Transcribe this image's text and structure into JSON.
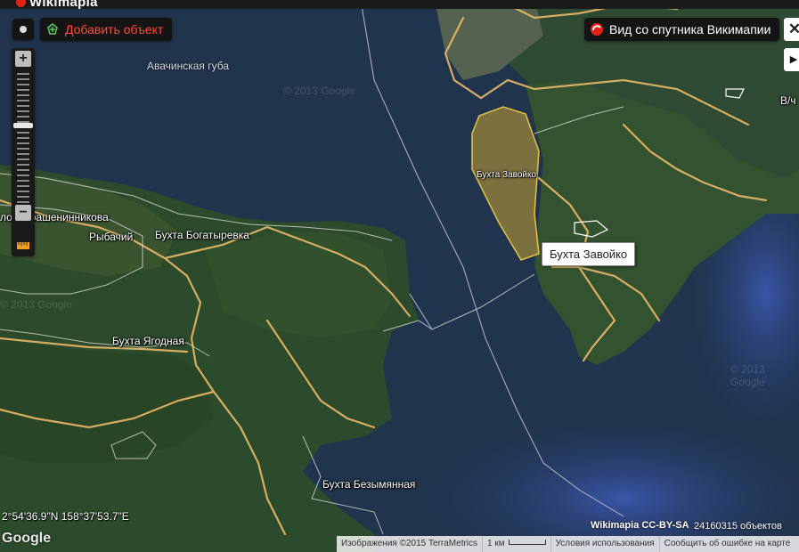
{
  "app": {
    "brand": "Wikimapia"
  },
  "toolbar": {
    "add_object_label": "Добавить объект",
    "satellite_view_label": "Вид со спутника Викимапии",
    "close_label": "✕",
    "expand_label": "▶"
  },
  "zoom": {
    "plus_label": "+",
    "minus_label": "−"
  },
  "map": {
    "places": {
      "avacha_bay": "Авачинская губа",
      "krasheninnikov_peninsula": "лов. Крашенинникова",
      "rybachy": "Рыбачий",
      "bogatyrevka_bay": "Бухта Богатыревка",
      "yagodnaya_bay": "Бухта Ягодная",
      "bezymyannaya_bay": "Бухта Безымянная",
      "zavoyko_bay_label": "Бухта Завойко",
      "vilyuchinsk_partial": "В/ч"
    },
    "watermark": "© 2013 Google",
    "tooltip": "Бухта Завойко",
    "highlight_color": "#c8a233"
  },
  "coords": "2°54'36.9\"N 158°37'53.7\"E",
  "google_logo": "Google",
  "license": "Wikimapia CC-BY-SA",
  "object_count": "24160315 объектов",
  "footer": {
    "imagery": "Изображения ©2015 TerraMetrics",
    "scale": "1 км",
    "terms": "Условия использования",
    "report": "Сообщить об ошибке на карте"
  }
}
